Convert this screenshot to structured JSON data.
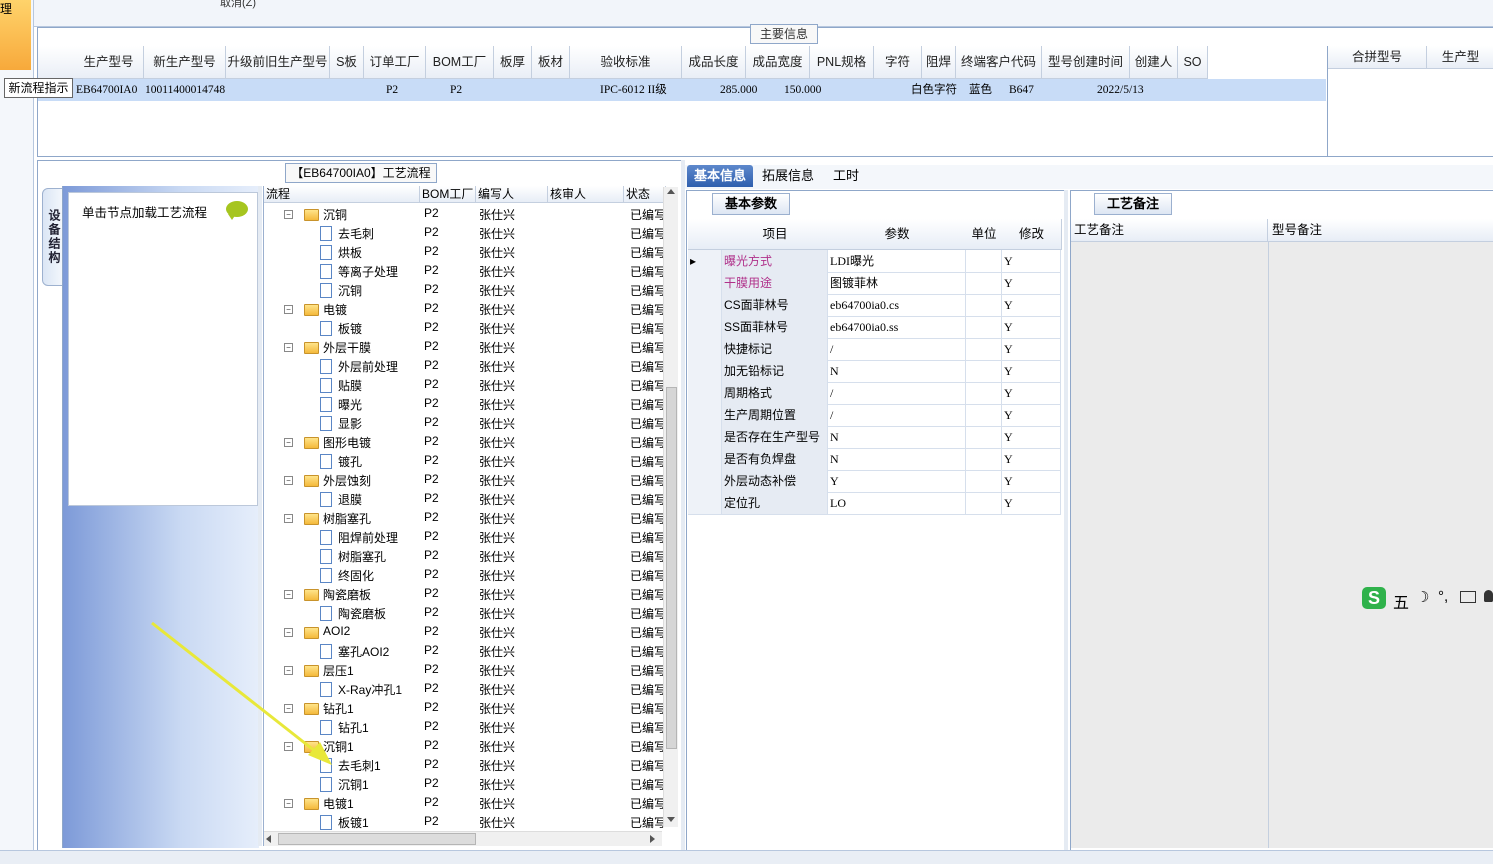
{
  "top": {
    "cut_text": "取消(Z)",
    "left_label": "理",
    "tooltip": "新流程指示"
  },
  "main_info": {
    "title": "主要信息",
    "columns": [
      "生产型号",
      "新生产型号",
      "升级前旧生产型号",
      "S板",
      "订单工厂",
      "BOM工厂",
      "板厚",
      "板材",
      "验收标准",
      "成品长度",
      "成品宽度",
      "PNL规格",
      "字符",
      "阻焊",
      "终端客户代码",
      "型号创建时间",
      "创建人",
      "SO"
    ],
    "row": {
      "model": "EB64700IA0",
      "new_model": "10011400014748",
      "old_model": "",
      "s_board": "",
      "order_factory": "P2",
      "bom_factory": "P2",
      "thickness": "",
      "material": "",
      "standard": "IPC-6012 II级",
      "length": "285.000",
      "width": "150.000",
      "pnl": "",
      "char": "白色字符",
      "solder": "蓝色",
      "customer": "B647",
      "created": "2022/5/13",
      "creator": "",
      "so": ""
    },
    "side_columns": [
      "合拼型号",
      "生产型"
    ]
  },
  "flow": {
    "title": "【EB64700IA0】工艺流程",
    "vertical_tab": "设备结构",
    "load_hint": "单击节点加载工艺流程",
    "columns": [
      "流程",
      "BOM工厂",
      "编写人",
      "核审人",
      "状态"
    ],
    "rows": [
      {
        "name": "沉铜",
        "type": "folder",
        "bom": "P2",
        "writer": "张仕兴",
        "reviewer": "",
        "status": "已编写"
      },
      {
        "name": "去毛刺",
        "type": "file",
        "bom": "P2",
        "writer": "张仕兴",
        "reviewer": "",
        "status": "已编写"
      },
      {
        "name": "烘板",
        "type": "file",
        "bom": "P2",
        "writer": "张仕兴",
        "reviewer": "",
        "status": "已编写"
      },
      {
        "name": "等离子处理",
        "type": "file",
        "bom": "P2",
        "writer": "张仕兴",
        "reviewer": "",
        "status": "已编写"
      },
      {
        "name": "沉铜",
        "type": "file",
        "bom": "P2",
        "writer": "张仕兴",
        "reviewer": "",
        "status": "已编写"
      },
      {
        "name": "电镀",
        "type": "folder",
        "bom": "P2",
        "writer": "张仕兴",
        "reviewer": "",
        "status": "已编写"
      },
      {
        "name": "板镀",
        "type": "file",
        "bom": "P2",
        "writer": "张仕兴",
        "reviewer": "",
        "status": "已编写"
      },
      {
        "name": "外层干膜",
        "type": "folder",
        "bom": "P2",
        "writer": "张仕兴",
        "reviewer": "",
        "status": "已编写"
      },
      {
        "name": "外层前处理",
        "type": "file",
        "bom": "P2",
        "writer": "张仕兴",
        "reviewer": "",
        "status": "已编写"
      },
      {
        "name": "贴膜",
        "type": "file",
        "bom": "P2",
        "writer": "张仕兴",
        "reviewer": "",
        "status": "已编写"
      },
      {
        "name": "曝光",
        "type": "file",
        "bom": "P2",
        "writer": "张仕兴",
        "reviewer": "",
        "status": "已编写"
      },
      {
        "name": "显影",
        "type": "file",
        "bom": "P2",
        "writer": "张仕兴",
        "reviewer": "",
        "status": "已编写"
      },
      {
        "name": "图形电镀",
        "type": "folder",
        "bom": "P2",
        "writer": "张仕兴",
        "reviewer": "",
        "status": "已编写"
      },
      {
        "name": "镀孔",
        "type": "file",
        "bom": "P2",
        "writer": "张仕兴",
        "reviewer": "",
        "status": "已编写"
      },
      {
        "name": "外层蚀刻",
        "type": "folder",
        "bom": "P2",
        "writer": "张仕兴",
        "reviewer": "",
        "status": "已编写"
      },
      {
        "name": "退膜",
        "type": "file",
        "bom": "P2",
        "writer": "张仕兴",
        "reviewer": "",
        "status": "已编写"
      },
      {
        "name": "树脂塞孔",
        "type": "folder",
        "bom": "P2",
        "writer": "张仕兴",
        "reviewer": "",
        "status": "已编写"
      },
      {
        "name": "阻焊前处理",
        "type": "file",
        "bom": "P2",
        "writer": "张仕兴",
        "reviewer": "",
        "status": "已编写"
      },
      {
        "name": "树脂塞孔",
        "type": "file",
        "bom": "P2",
        "writer": "张仕兴",
        "reviewer": "",
        "status": "已编写"
      },
      {
        "name": "终固化",
        "type": "file",
        "bom": "P2",
        "writer": "张仕兴",
        "reviewer": "",
        "status": "已编写"
      },
      {
        "name": "陶瓷磨板",
        "type": "folder",
        "bom": "P2",
        "writer": "张仕兴",
        "reviewer": "",
        "status": "已编写"
      },
      {
        "name": "陶瓷磨板",
        "type": "file",
        "bom": "P2",
        "writer": "张仕兴",
        "reviewer": "",
        "status": "已编写"
      },
      {
        "name": "AOI2",
        "type": "folder",
        "bom": "P2",
        "writer": "张仕兴",
        "reviewer": "",
        "status": "已编写"
      },
      {
        "name": "塞孔AOI2",
        "type": "file",
        "bom": "P2",
        "writer": "张仕兴",
        "reviewer": "",
        "status": "已编写"
      },
      {
        "name": "层压1",
        "type": "folder",
        "bom": "P2",
        "writer": "张仕兴",
        "reviewer": "",
        "status": "已编写"
      },
      {
        "name": "X-Ray冲孔1",
        "type": "file",
        "bom": "P2",
        "writer": "张仕兴",
        "reviewer": "",
        "status": "已编写"
      },
      {
        "name": "钻孔1",
        "type": "folder",
        "bom": "P2",
        "writer": "张仕兴",
        "reviewer": "",
        "status": "已编写"
      },
      {
        "name": "钻孔1",
        "type": "file",
        "bom": "P2",
        "writer": "张仕兴",
        "reviewer": "",
        "status": "已编写"
      },
      {
        "name": "沉铜1",
        "type": "folder",
        "bom": "P2",
        "writer": "张仕兴",
        "reviewer": "",
        "status": "已编写"
      },
      {
        "name": "去毛刺1",
        "type": "file",
        "bom": "P2",
        "writer": "张仕兴",
        "reviewer": "",
        "status": "已编写"
      },
      {
        "name": "沉铜1",
        "type": "file",
        "bom": "P2",
        "writer": "张仕兴",
        "reviewer": "",
        "status": "已编写"
      },
      {
        "name": "电镀1",
        "type": "folder",
        "bom": "P2",
        "writer": "张仕兴",
        "reviewer": "",
        "status": "已编写"
      },
      {
        "name": "板镀1",
        "type": "file",
        "bom": "P2",
        "writer": "张仕兴",
        "reviewer": "",
        "status": "已编写"
      }
    ]
  },
  "tabs": {
    "basic": "基本信息",
    "ext": "拓展信息",
    "hours": "工时"
  },
  "basic": {
    "subtab": "基本参数",
    "columns": [
      "项目",
      "参数",
      "单位",
      "修改"
    ],
    "rows": [
      {
        "item": "曝光方式",
        "param": "LDI曝光",
        "unit": "",
        "modify": "Y",
        "highlight": true
      },
      {
        "item": "干膜用途",
        "param": "图镀菲林",
        "unit": "",
        "modify": "Y",
        "highlight": true
      },
      {
        "item": "CS面菲林号",
        "param": "eb64700ia0.cs",
        "unit": "",
        "modify": "Y",
        "highlight": false
      },
      {
        "item": "SS面菲林号",
        "param": "eb64700ia0.ss",
        "unit": "",
        "modify": "Y",
        "highlight": false
      },
      {
        "item": "快捷标记",
        "param": "/",
        "unit": "",
        "modify": "Y",
        "highlight": false
      },
      {
        "item": "加无铅标记",
        "param": "N",
        "unit": "",
        "modify": "Y",
        "highlight": false
      },
      {
        "item": "周期格式",
        "param": "/",
        "unit": "",
        "modify": "Y",
        "highlight": false
      },
      {
        "item": "生产周期位置",
        "param": "/",
        "unit": "",
        "modify": "Y",
        "highlight": false
      },
      {
        "item": "是否存在生产型号",
        "param": "N",
        "unit": "",
        "modify": "Y",
        "highlight": false
      },
      {
        "item": "是否有负焊盘",
        "param": "N",
        "unit": "",
        "modify": "Y",
        "highlight": false
      },
      {
        "item": "外层动态补偿",
        "param": "Y",
        "unit": "",
        "modify": "Y",
        "highlight": false
      },
      {
        "item": "定位孔",
        "param": "LO",
        "unit": "",
        "modify": "Y",
        "highlight": false
      }
    ]
  },
  "remark": {
    "subtab": "工艺备注",
    "col1": "工艺备注",
    "col2": "型号备注"
  },
  "ime": {
    "logo": "S",
    "mode": "五"
  },
  "colors": {
    "accent": "#2f5fae",
    "highlight_text": "#b0308a",
    "selected_row": "#c8dcf7"
  }
}
